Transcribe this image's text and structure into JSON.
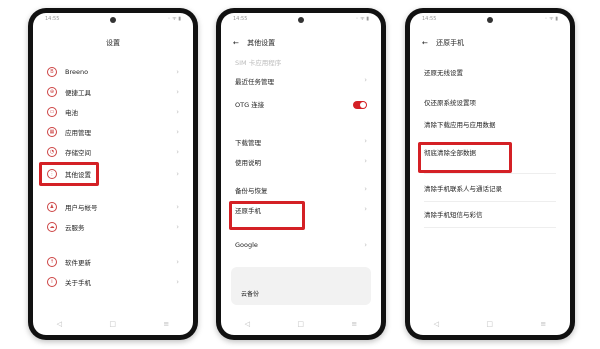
{
  "status": {
    "time": "14:55",
    "icons": "◦ ᯤ ▮"
  },
  "nav": {
    "back": "◁",
    "home": "□",
    "menu": "≡"
  },
  "chevron": "›",
  "back_arrow": "←",
  "screen1": {
    "title": "设置",
    "items": [
      {
        "label": "Breeno",
        "icon": "B"
      },
      {
        "label": "便捷工具",
        "icon": "⊕"
      },
      {
        "label": "电池",
        "icon": "▭"
      },
      {
        "label": "应用管理",
        "icon": "▦"
      },
      {
        "label": "存储空间",
        "icon": "◔"
      },
      {
        "label": "其他设置",
        "icon": "⋮"
      },
      {
        "label": "用户与帐号",
        "icon": "♟"
      },
      {
        "label": "云服务",
        "icon": "☁"
      },
      {
        "label": "软件更新",
        "icon": "↑"
      },
      {
        "label": "关于手机",
        "icon": "i"
      }
    ]
  },
  "screen2": {
    "title": "其他设置",
    "faded_item": "SIM 卡应用程序",
    "items": [
      {
        "label": "最近任务管理"
      },
      {
        "label": "OTG 连接",
        "sub": ""
      },
      {
        "label": "下载管理"
      },
      {
        "label": "使用说明"
      },
      {
        "label": "备份与恢复"
      },
      {
        "label": "还原手机",
        "sub": ""
      },
      {
        "label": "Google"
      }
    ],
    "card": {
      "prompt": "",
      "link": "云备份"
    }
  },
  "screen3": {
    "title": "还原手机",
    "items": [
      {
        "label": "还原无线设置",
        "sub": ""
      },
      {
        "label": "仅还原系统设置项"
      },
      {
        "label": "清除下载应用与应用数据",
        "sub": ""
      },
      {
        "label": "彻底清除全部数据",
        "sub": ""
      },
      {
        "label": "清除手机联系人与通话记录",
        "sub": ""
      },
      {
        "label": "清除手机短信与彩信",
        "sub": ""
      }
    ]
  },
  "colors": {
    "highlight": "#d42025",
    "toggle_on": "#d42025",
    "icon": "#c44444"
  }
}
